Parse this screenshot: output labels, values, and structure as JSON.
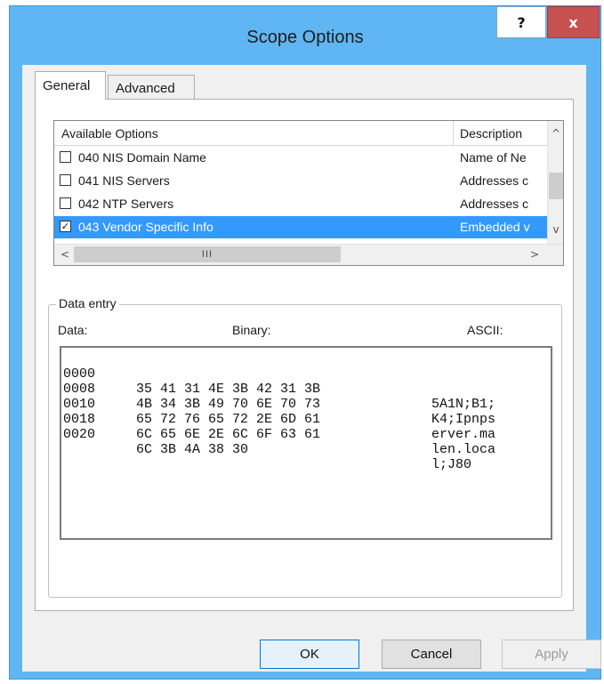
{
  "window": {
    "title": "Scope Options",
    "help_label": "?",
    "close_label": "x"
  },
  "tabs": [
    {
      "label": "General",
      "active": true
    },
    {
      "label": "Advanced",
      "active": false
    }
  ],
  "options_list": {
    "column_name": "Available Options",
    "column_description": "Description",
    "rows": [
      {
        "name": "040 NIS Domain Name",
        "description": "Name of Ne",
        "checked": false,
        "selected": false
      },
      {
        "name": "041 NIS Servers",
        "description": "Addresses c",
        "checked": false,
        "selected": false
      },
      {
        "name": "042 NTP Servers",
        "description": "Addresses c",
        "checked": false,
        "selected": false
      },
      {
        "name": "043 Vendor Specific Info",
        "description": "Embedded v",
        "checked": true,
        "selected": true
      }
    ],
    "scroll_thumb_label": "III"
  },
  "data_entry": {
    "group_title": "Data entry",
    "label_data": "Data:",
    "label_binary": "Binary:",
    "label_ascii": "ASCII:",
    "lines": [
      {
        "offset": "0000",
        "bytes": "35 41 31 4E 3B 42 31 3B",
        "ascii": "5A1N;B1;"
      },
      {
        "offset": "0008",
        "bytes": "4B 34 3B 49 70 6E 70 73",
        "ascii": "K4;Ipnps"
      },
      {
        "offset": "0010",
        "bytes": "65 72 76 65 72 2E 6D 61",
        "ascii": "erver.ma"
      },
      {
        "offset": "0018",
        "bytes": "6C 65 6E 2E 6C 6F 63 61",
        "ascii": "len.loca"
      },
      {
        "offset": "0020",
        "bytes": "6C 3B 4A 38 30",
        "ascii": "l;J80"
      }
    ]
  },
  "buttons": {
    "ok": "OK",
    "cancel": "Cancel",
    "apply": "Apply"
  },
  "colors": {
    "frame": "#5fb6f2",
    "close_button": "#c75050",
    "selection": "#3399ff"
  }
}
